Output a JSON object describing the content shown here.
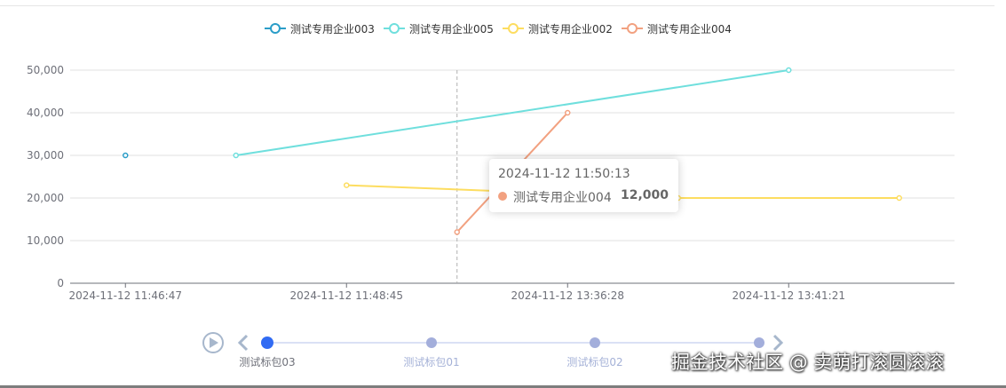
{
  "chart_data": {
    "type": "line",
    "categories": [
      "2024-11-12 11:46:47",
      "",
      "2024-11-12 11:48:45",
      "",
      "2024-11-12 13:36:28",
      "",
      "2024-11-12 13:41:21",
      ""
    ],
    "series": [
      {
        "name": "测试专用企业003",
        "color": "#2a9dc8",
        "values": [
          30000,
          null,
          null,
          null,
          null,
          null,
          null,
          null
        ]
      },
      {
        "name": "测试专用企业005",
        "color": "#6fdfdd",
        "values": [
          null,
          30000,
          null,
          null,
          null,
          null,
          50000,
          null
        ]
      },
      {
        "name": "测试专用企业002",
        "color": "#fddd60",
        "values": [
          null,
          null,
          23000,
          null,
          null,
          20000,
          null,
          20000
        ]
      },
      {
        "name": "测试专用企业004",
        "color": "#f2a180",
        "values": [
          null,
          null,
          null,
          12000,
          40000,
          null,
          null,
          null
        ]
      }
    ],
    "yticks": [
      "50,000",
      "40,000",
      "30,000",
      "20,000",
      "10,000",
      "0"
    ],
    "ylim": [
      0,
      50000
    ],
    "grid": true,
    "legend_position": "top-center"
  },
  "tooltip": {
    "title": "2024-11-12 11:50:13",
    "series_name": "测试专用企业004",
    "value": "12,000",
    "color": "#f2a180"
  },
  "timeline": {
    "items": [
      "测试标包03",
      "测试标包01",
      "测试标包02",
      ""
    ],
    "active_index": 0,
    "play_icon": "play-icon",
    "prev_icon": "chevron-left-icon",
    "next_icon": "chevron-right-icon"
  },
  "watermark": "掘金技术社区 @ 卖萌打滚圆滚滚"
}
